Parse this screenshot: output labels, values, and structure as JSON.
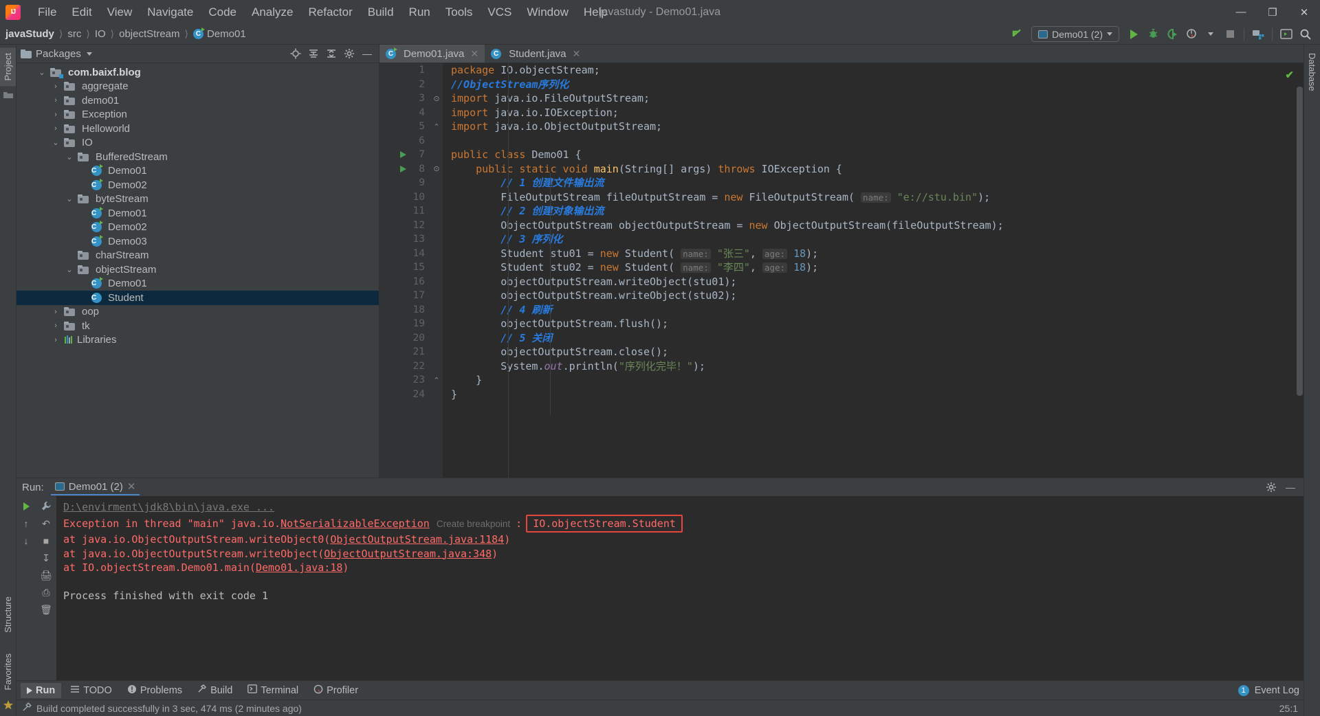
{
  "window": {
    "title": "javastudy - Demo01.java",
    "logo_text": "IJ",
    "minimize": "—",
    "maximize": "❐",
    "close": "✕"
  },
  "menu": [
    {
      "label": "File"
    },
    {
      "label": "Edit"
    },
    {
      "label": "View"
    },
    {
      "label": "Navigate"
    },
    {
      "label": "Code"
    },
    {
      "label": "Analyze"
    },
    {
      "label": "Refactor"
    },
    {
      "label": "Build"
    },
    {
      "label": "Run"
    },
    {
      "label": "Tools"
    },
    {
      "label": "VCS"
    },
    {
      "label": "Window"
    },
    {
      "label": "Help"
    }
  ],
  "navbar": {
    "crumbs": [
      "javaStudy",
      "src",
      "IO",
      "objectStream",
      "Demo01"
    ],
    "separator": "〉",
    "run_config": "Demo01 (2)",
    "icons": {
      "updateproject": "update-project-icon",
      "run": "run-icon",
      "debug": "debug-icon",
      "coverage": "run-with-coverage-icon",
      "profile": "profile-icon",
      "stop": "stop-icon",
      "project_structure": "project-structure-icon",
      "terminal": "terminal-icon",
      "search": "search-everywhere-icon"
    }
  },
  "left_strip": {
    "tabs": [
      "Project"
    ],
    "structure": "Structure",
    "favorites": "Favorites"
  },
  "right_strip": {
    "tabs": [
      "Database"
    ]
  },
  "project_pane": {
    "title": "Packages",
    "tree": [
      {
        "indent": 0,
        "chev": "⌄",
        "type": "pkg-root",
        "label": "com.baixf.blog",
        "bold": true
      },
      {
        "indent": 1,
        "chev": "›",
        "type": "pkg",
        "label": "aggregate",
        "bold": false
      },
      {
        "indent": 1,
        "chev": "›",
        "type": "pkg",
        "label": "demo01",
        "bold": false
      },
      {
        "indent": 1,
        "chev": "›",
        "type": "pkg",
        "label": "Exception",
        "bold": false
      },
      {
        "indent": 1,
        "chev": "›",
        "type": "pkg",
        "label": "Helloworld",
        "bold": false
      },
      {
        "indent": 1,
        "chev": "⌄",
        "type": "pkg",
        "label": "IO",
        "bold": false
      },
      {
        "indent": 2,
        "chev": "⌄",
        "type": "pkg",
        "label": "BufferedStream",
        "bold": false
      },
      {
        "indent": 3,
        "chev": "",
        "type": "class-run",
        "label": "Demo01",
        "bold": false
      },
      {
        "indent": 3,
        "chev": "",
        "type": "class-run",
        "label": "Demo02",
        "bold": false
      },
      {
        "indent": 2,
        "chev": "⌄",
        "type": "pkg",
        "label": "byteStream",
        "bold": false
      },
      {
        "indent": 3,
        "chev": "",
        "type": "class-run",
        "label": "Demo01",
        "bold": false
      },
      {
        "indent": 3,
        "chev": "",
        "type": "class-run",
        "label": "Demo02",
        "bold": false
      },
      {
        "indent": 3,
        "chev": "",
        "type": "class-run",
        "label": "Demo03",
        "bold": false
      },
      {
        "indent": 2,
        "chev": "",
        "type": "pkg",
        "label": "charStream",
        "bold": false
      },
      {
        "indent": 2,
        "chev": "⌄",
        "type": "pkg",
        "label": "objectStream",
        "bold": false
      },
      {
        "indent": 3,
        "chev": "",
        "type": "class-run",
        "label": "Demo01",
        "bold": false
      },
      {
        "indent": 3,
        "chev": "",
        "type": "class",
        "label": "Student",
        "bold": false,
        "selected": true
      },
      {
        "indent": 1,
        "chev": "›",
        "type": "pkg",
        "label": "oop",
        "bold": false
      },
      {
        "indent": 1,
        "chev": "›",
        "type": "pkg",
        "label": "tk",
        "bold": false
      },
      {
        "indent": 1,
        "chev": "›",
        "type": "lib",
        "label": "Libraries",
        "bold": false
      }
    ]
  },
  "editor": {
    "tabs": [
      {
        "label": "Demo01.java",
        "icon": "java-class-run-icon",
        "active": true,
        "close": "✕"
      },
      {
        "label": "Student.java",
        "icon": "java-class-icon",
        "active": false,
        "close": "✕"
      }
    ],
    "line_count": 24,
    "lines": [
      {
        "n": 1,
        "run": false,
        "fold": "",
        "html": "<span class=\"kw\">package</span> IO.objectStream;"
      },
      {
        "n": 2,
        "run": false,
        "fold": "",
        "html": "<span class=\"cmt-zh\">//ObjectStream序列化</span>"
      },
      {
        "n": 3,
        "run": false,
        "fold": "⊙",
        "html": "<span class=\"kw\">import</span> java.io.FileOutputStream;"
      },
      {
        "n": 4,
        "run": false,
        "fold": "",
        "html": "<span class=\"kw\">import</span> java.io.IOException;"
      },
      {
        "n": 5,
        "run": false,
        "fold": "⌃",
        "html": "<span class=\"kw\">import</span> java.io.ObjectOutputStream;"
      },
      {
        "n": 6,
        "run": false,
        "fold": "",
        "html": ""
      },
      {
        "n": 7,
        "run": true,
        "fold": "",
        "html": "<span class=\"kw\">public class</span> Demo01 {"
      },
      {
        "n": 8,
        "run": true,
        "fold": "⊙",
        "html": "    <span class=\"kw\">public static void</span> <span class=\"mth\">main</span>(String[] args) <span class=\"kw\">throws</span> IOException {"
      },
      {
        "n": 9,
        "run": false,
        "fold": "",
        "html": "        <span class=\"cmt-zh\">// 1 创建文件输出流</span>"
      },
      {
        "n": 10,
        "run": false,
        "fold": "",
        "html": "        FileOutputStream fileOutputStream = <span class=\"kw\">new</span> FileOutputStream( <span class=\"hint\">name:</span> <span class=\"str\">\"e://stu.bin\"</span>);"
      },
      {
        "n": 11,
        "run": false,
        "fold": "",
        "html": "        <span class=\"cmt-zh\">// 2 创建对象输出流</span>"
      },
      {
        "n": 12,
        "run": false,
        "fold": "",
        "html": "        ObjectOutputStream objectOutputStream = <span class=\"kw\">new</span> ObjectOutputStream(fileOutputStream);"
      },
      {
        "n": 13,
        "run": false,
        "fold": "",
        "html": "        <span class=\"cmt-zh\">// 3 序列化</span>"
      },
      {
        "n": 14,
        "run": false,
        "fold": "",
        "html": "        Student stu01 = <span class=\"kw\">new</span> Student( <span class=\"hint\">name:</span> <span class=\"str\">\"张三\"</span>, <span class=\"hint\">age:</span> <span class=\"num\">18</span>);"
      },
      {
        "n": 15,
        "run": false,
        "fold": "",
        "html": "        Student stu02 = <span class=\"kw\">new</span> Student( <span class=\"hint\">name:</span> <span class=\"str\">\"李四\"</span>, <span class=\"hint\">age:</span> <span class=\"num\">18</span>);"
      },
      {
        "n": 16,
        "run": false,
        "fold": "",
        "html": "        objectOutputStream.writeObject(stu01);"
      },
      {
        "n": 17,
        "run": false,
        "fold": "",
        "html": "        objectOutputStream.writeObject(stu02);"
      },
      {
        "n": 18,
        "run": false,
        "fold": "",
        "html": "        <span class=\"cmt-zh\">// 4 刷新</span>"
      },
      {
        "n": 19,
        "run": false,
        "fold": "",
        "html": "        objectOutputStream.flush();"
      },
      {
        "n": 20,
        "run": false,
        "fold": "",
        "html": "        <span class=\"cmt-zh\">// 5 关闭</span>"
      },
      {
        "n": 21,
        "run": false,
        "fold": "",
        "html": "        objectOutputStream.close();"
      },
      {
        "n": 22,
        "run": false,
        "fold": "",
        "html": "        System.<span class=\"fld\">out</span>.println(<span class=\"str\">\"序列化完毕！\"</span>);"
      },
      {
        "n": 23,
        "run": false,
        "fold": "⌃",
        "html": "    }"
      },
      {
        "n": 24,
        "run": false,
        "fold": "",
        "html": "}"
      }
    ],
    "inspection_ok": "✔"
  },
  "run_window": {
    "label": "Run:",
    "tab": "Demo01 (2)",
    "tab_close": "✕",
    "settings_icon": "gear-icon",
    "hide_icon": "—",
    "console": {
      "cmd": "D:\\envirment\\jdk8\\bin\\java.exe ...",
      "exception_prefix": "Exception in thread \"main\" java.io.",
      "exception_type": "NotSerializableException",
      "breakpoint_hint": "Create breakpoint",
      "highlight_class": "IO.objectStream.Student",
      "stack": [
        {
          "prefix": "    at java.io.ObjectOutputStream.writeObject0(",
          "link": "ObjectOutputStream.java:1184",
          "suffix": ")"
        },
        {
          "prefix": "    at java.io.ObjectOutputStream.writeObject(",
          "link": "ObjectOutputStream.java:348",
          "suffix": ")"
        },
        {
          "prefix": "    at IO.objectStream.Demo01.main(",
          "link": "Demo01.java:18",
          "suffix": ")"
        }
      ],
      "exit_line": "Process finished with exit code 1"
    }
  },
  "bottom_tabs": [
    {
      "label": "Run",
      "icon": "run-icon",
      "active": true
    },
    {
      "label": "TODO",
      "icon": "todo-icon",
      "active": false
    },
    {
      "label": "Problems",
      "icon": "problems-icon",
      "active": false
    },
    {
      "label": "Build",
      "icon": "build-icon",
      "active": false
    },
    {
      "label": "Terminal",
      "icon": "terminal-icon",
      "active": false
    },
    {
      "label": "Profiler",
      "icon": "profiler-icon",
      "active": false
    }
  ],
  "event_log": {
    "count": "1",
    "label": "Event Log"
  },
  "statusbar": {
    "message": "Build completed successfully in 3 sec, 474 ms (2 minutes ago)",
    "caret": "25:1",
    "hammer_icon": "build-hammer-icon"
  },
  "colors": {
    "accent": "#3592c4",
    "run_green": "#62b543",
    "error_red": "#e8453c",
    "error_text": "#ff6b68",
    "selection": "#0d293e",
    "comment_blue": "#287bde",
    "keyword_orange": "#cc7832",
    "string_green": "#6a8759"
  }
}
